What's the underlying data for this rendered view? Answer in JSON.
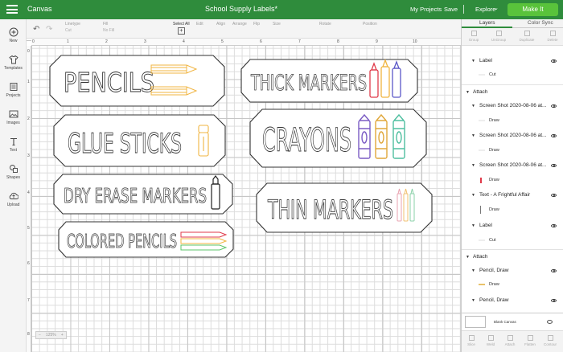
{
  "topbar": {
    "app_name": "Canvas",
    "doc_title": "School Supply Labels*",
    "my_projects": "My Projects",
    "save": "Save",
    "separator": "|",
    "explore": "Explore",
    "make_it": "Make It"
  },
  "toolbar": {
    "linetype_label": "Linetype",
    "linetype_value": "Cut",
    "fill_label": "Fill",
    "fill_value": "No Fill",
    "select_all": "Select All",
    "edit_label": "Edit",
    "align_label": "Align",
    "arrange_label": "Arrange",
    "flip_label": "Flip",
    "size_label": "Size",
    "rotate_label": "Rotate",
    "position_label": "Position"
  },
  "sidebar": {
    "items": [
      {
        "label": "New",
        "icon": "plus-circle-icon"
      },
      {
        "label": "Templates",
        "icon": "shirt-icon"
      },
      {
        "label": "Projects",
        "icon": "projects-icon"
      },
      {
        "label": "Images",
        "icon": "image-icon"
      },
      {
        "label": "Text",
        "icon": "text-icon"
      },
      {
        "label": "Shapes",
        "icon": "shapes-icon"
      },
      {
        "label": "Upload",
        "icon": "upload-icon"
      }
    ]
  },
  "ruler": {
    "top": [
      "0",
      "1",
      "2",
      "3",
      "4",
      "5",
      "6",
      "7",
      "8",
      "9",
      "10"
    ],
    "left": [
      "0",
      "1",
      "2",
      "3",
      "4",
      "5",
      "6",
      "7",
      "8"
    ]
  },
  "labels": {
    "pencils": "PENCILS",
    "glue_sticks": "GLUE STICKS",
    "dry_erase": "DRY ERASE MARKERS",
    "colored_pencils": "COLORED PENCILS",
    "thick_markers": "THICK MARKERS",
    "crayons": "CRAYONS",
    "thin_markers": "THIN MARKERS"
  },
  "zoom": {
    "minus": "−",
    "value": "125%",
    "plus": "+"
  },
  "panel": {
    "tab_layers": "Layers",
    "tab_color_sync": "Color Sync",
    "tools": [
      "Group",
      "UnGroup",
      "Duplicate",
      "Delete"
    ],
    "layers": [
      {
        "kind": "row",
        "label": "Label",
        "indent": 1
      },
      {
        "kind": "sub",
        "label": "Cut",
        "color": "#ffffff"
      },
      {
        "kind": "group",
        "label": "Attach"
      },
      {
        "kind": "row",
        "label": "Screen Shot 2020-08-06 at...",
        "indent": 1
      },
      {
        "kind": "sub",
        "label": "Draw",
        "color": "#ffffff"
      },
      {
        "kind": "row",
        "label": "Screen Shot 2020-08-06 at...",
        "indent": 1
      },
      {
        "kind": "sub",
        "label": "Draw",
        "color": "#ffffff"
      },
      {
        "kind": "row",
        "label": "Screen Shot 2020-08-06 at...",
        "indent": 1
      },
      {
        "kind": "sub",
        "label": "Draw",
        "color": "#e03a4a"
      },
      {
        "kind": "row",
        "label": "Text - A Frightful Affair",
        "indent": 1
      },
      {
        "kind": "sub",
        "label": "Draw",
        "color": "#777777"
      },
      {
        "kind": "row",
        "label": "Label",
        "indent": 1
      },
      {
        "kind": "sub",
        "label": "Cut",
        "color": "#ffffff"
      },
      {
        "kind": "group",
        "label": "Attach"
      },
      {
        "kind": "row",
        "label": "Pencil, Draw",
        "indent": 1
      },
      {
        "kind": "sub",
        "label": "Draw",
        "color": "#e9c26a"
      },
      {
        "kind": "row",
        "label": "Pencil, Draw",
        "indent": 1
      }
    ],
    "blank_canvas": "Blank Canvas",
    "bottom_tools": [
      "Slice",
      "Weld",
      "Attach",
      "Flatten",
      "Contour"
    ]
  },
  "colors": {
    "brand_green": "#2f8c3c",
    "make_it_green": "#59c33b",
    "pencil_yellow": "#f0b440",
    "crayon_purple": "#7b5cc4",
    "crayon_teal": "#4fbfa0"
  }
}
